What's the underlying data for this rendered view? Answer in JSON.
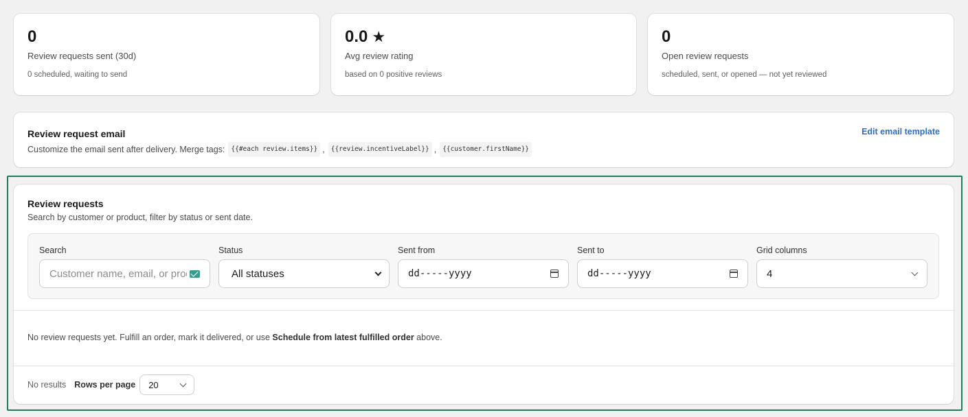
{
  "stats": [
    {
      "value": "0",
      "label": "Review requests sent (30d)",
      "sub": "0 scheduled, waiting to send"
    },
    {
      "value": "0.0",
      "label": "Avg review rating",
      "sub": "based on 0 positive reviews",
      "icon": "star-icon"
    },
    {
      "value": "0",
      "label": "Open review requests",
      "sub": "scheduled, sent, or opened — not yet reviewed"
    }
  ],
  "email_card": {
    "title": "Review request email",
    "desc": "Customize the email sent after delivery. Merge tags:",
    "tags": [
      "{{#each review.items}}",
      "{{review.incentiveLabel}}",
      "{{customer.firstName}}"
    ],
    "edit_link": "Edit email template"
  },
  "requests": {
    "title": "Review requests",
    "subtitle": "Search by customer or product, filter by status or sent date.",
    "filters": {
      "search": {
        "label": "Search",
        "placeholder": "Customer name, email, or prod"
      },
      "status": {
        "label": "Status",
        "value": "All statuses"
      },
      "sent_from": {
        "label": "Sent from",
        "value": "dd-----yyyy"
      },
      "sent_to": {
        "label": "Sent to",
        "value": "dd-----yyyy"
      },
      "grid_columns": {
        "label": "Grid columns",
        "value": "4"
      }
    },
    "empty": {
      "text_before": "No review requests yet. Fulfill an order, mark it delivered, or use ",
      "bold": "Schedule from latest fulfilled order",
      "text_after": " above."
    },
    "footer": {
      "no_results": "No results",
      "rows_per_page_label": "Rows per page",
      "rows_per_page_value": "20"
    }
  },
  "colors": {
    "focus_outline": "#1f7a5a",
    "link": "#2c6ecb",
    "background": "#f1f1f1"
  }
}
